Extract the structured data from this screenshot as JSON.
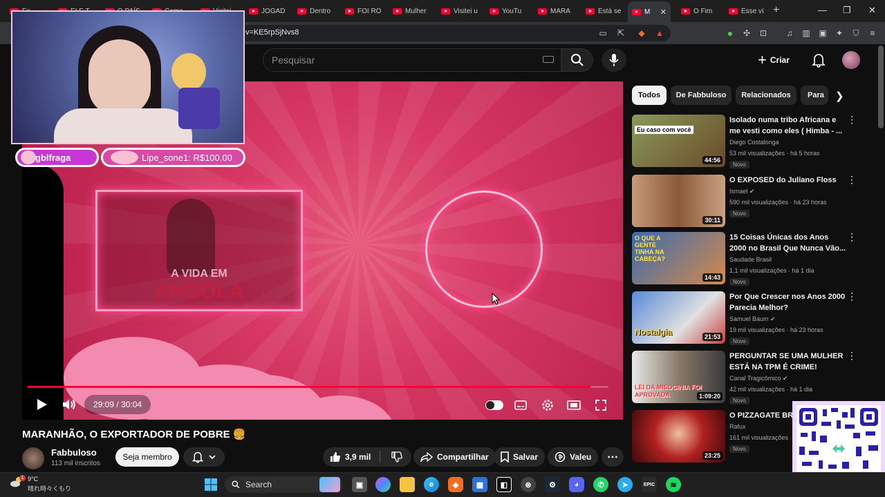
{
  "browser": {
    "tabs": [
      {
        "label": "Fe..."
      },
      {
        "label": "ELE T..."
      },
      {
        "label": "O PAÍS..."
      },
      {
        "label": "Como..."
      },
      {
        "label": "Visitei..."
      },
      {
        "label": "JOGAD"
      },
      {
        "label": "Dentro"
      },
      {
        "label": "FOI RO"
      },
      {
        "label": "Mulher"
      },
      {
        "label": "Visitei u"
      },
      {
        "label": "YouTu"
      },
      {
        "label": "MARA"
      },
      {
        "label": "Está se"
      },
      {
        "label": "M"
      },
      {
        "label": "O Fim"
      },
      {
        "label": "Esse ví"
      }
    ],
    "url": "v=KE5rpSjNvs8"
  },
  "header": {
    "search_placeholder": "Pesquisar",
    "create_label": "Criar"
  },
  "overlay": {
    "badge1": "gblfraga",
    "badge2": "Lipe_sone1: R$100.00"
  },
  "player": {
    "frame_title": "A VIDA EM",
    "frame_subtitle": "ANGOLA",
    "time": "29:09 / 30:04",
    "progress": 0.969,
    "colors": {
      "progress": "#ff0033",
      "bg": "#d63763"
    }
  },
  "video": {
    "title": "MARANHÃO, O EXPORTADOR DE POBRE 🍔",
    "channel": "Fabbuloso",
    "subscribers": "113 mil inscritos",
    "member_label": "Seja membro",
    "likes": "3,9 mil",
    "share_label": "Compartilhar",
    "save_label": "Salvar",
    "thanks_label": "Valeu"
  },
  "chips": [
    "Todos",
    "De Fabbuloso",
    "Relacionados",
    "Para"
  ],
  "recommendations": [
    {
      "title": "Isolado numa tribo Africana e me vesti como eles ( Himba - ...",
      "channel": "Diego Costalonga",
      "meta": "53 mil visualizações · há 5 horas",
      "badge": "Novo",
      "duration": "44:56",
      "caption": "Eu caso com você",
      "color": "#7a8a4a"
    },
    {
      "title": "O EXPOSED do Juliano Floss",
      "channel": "Ismael",
      "meta": "590 mil visualizações · há 23 horas",
      "badge": "Novo",
      "duration": "30:11",
      "caption": "",
      "color": "#b07a5a"
    },
    {
      "title": "15 Coisas Únicas dos Anos 2000 no Brasil Que Nunca Vão...",
      "channel": "Saudade Brasil",
      "meta": "1,1 mil visualizações · há 1 dia",
      "badge": "Novo",
      "duration": "14:43",
      "caption": "O QUE A GENTE TINHA NA CABEÇA?",
      "color": "#3a6ab0"
    },
    {
      "title": "Por Que Crescer nos Anos 2000 Parecia Melhor?",
      "channel": "Samuel Baum",
      "meta": "19 mil visualizações · há 23 horas",
      "badge": "Novo",
      "duration": "21:53",
      "caption": "Nostalgia",
      "color": "#4a7ac8"
    },
    {
      "title": "PERGUNTAR SE UMA MULHER ESTÁ NA TPM É CRIME!",
      "channel": "Canal Tragicômico",
      "meta": "42 mil visualizações · há 1 dia",
      "badge": "Novo",
      "duration": "1:09:20",
      "caption": "LEI DA MISOGINIA FOI APROVADA",
      "color": "#7a6a5a"
    },
    {
      "title": "O PIZZAGATE BRA...",
      "channel": "Rafux",
      "meta": "161 mil visualizações",
      "badge": "Novo",
      "duration": "23:25",
      "caption": "",
      "color": "#b02020"
    }
  ],
  "taskbar": {
    "temp": "9°C",
    "weather": "晴れ時々くもり",
    "search_label": "Search"
  }
}
